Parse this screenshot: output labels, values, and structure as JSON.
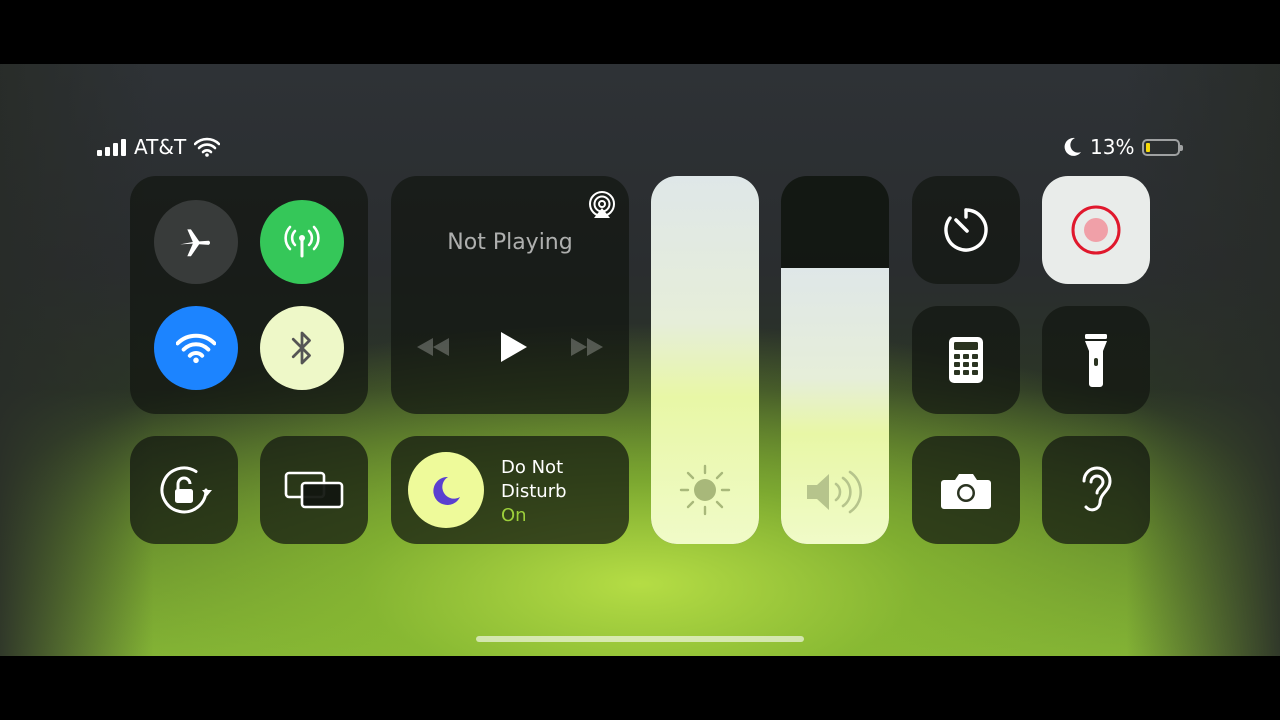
{
  "status": {
    "carrier": "AT&T",
    "battery_percent": "13%",
    "battery_level": 0.13,
    "icons": [
      "signal-bars-icon",
      "wifi-icon",
      "moon-icon",
      "battery-icon"
    ]
  },
  "connectivity": {
    "airplane": {
      "icon": "airplane-icon",
      "active": false
    },
    "cellular": {
      "icon": "antenna-icon",
      "active": true,
      "color": "#35c759"
    },
    "wifi": {
      "icon": "wifi-icon",
      "active": true,
      "color": "#1c84ff"
    },
    "bluetooth": {
      "icon": "bluetooth-icon",
      "active": true
    }
  },
  "now_playing": {
    "title": "Not Playing",
    "icons": [
      "airplay-icon",
      "rewind-icon",
      "play-icon",
      "fast-forward-icon"
    ]
  },
  "dnd": {
    "line1": "Do Not",
    "line2": "Disturb",
    "status": "On",
    "icon": "moon-icon"
  },
  "brightness": {
    "level": 1.0,
    "icon": "sun-icon"
  },
  "volume": {
    "level": 0.75,
    "icon": "speaker-icon"
  },
  "controls": [
    {
      "name": "timer",
      "icon": "timer-icon"
    },
    {
      "name": "screen-record",
      "icon": "record-icon",
      "active": true
    },
    {
      "name": "calculator",
      "icon": "calculator-icon"
    },
    {
      "name": "flashlight",
      "icon": "flashlight-icon"
    },
    {
      "name": "camera",
      "icon": "camera-icon"
    },
    {
      "name": "hearing",
      "icon": "ear-icon"
    },
    {
      "name": "orientation-lock",
      "icon": "rotation-lock-icon"
    },
    {
      "name": "screen-mirroring",
      "icon": "screen-mirroring-icon"
    }
  ],
  "colors": {
    "accent_green": "#35c759",
    "accent_blue": "#1c84ff",
    "record_red": "#e0182d",
    "dnd_on_green": "#9ccf3b",
    "battery_low_yellow": "#f5d90a"
  }
}
